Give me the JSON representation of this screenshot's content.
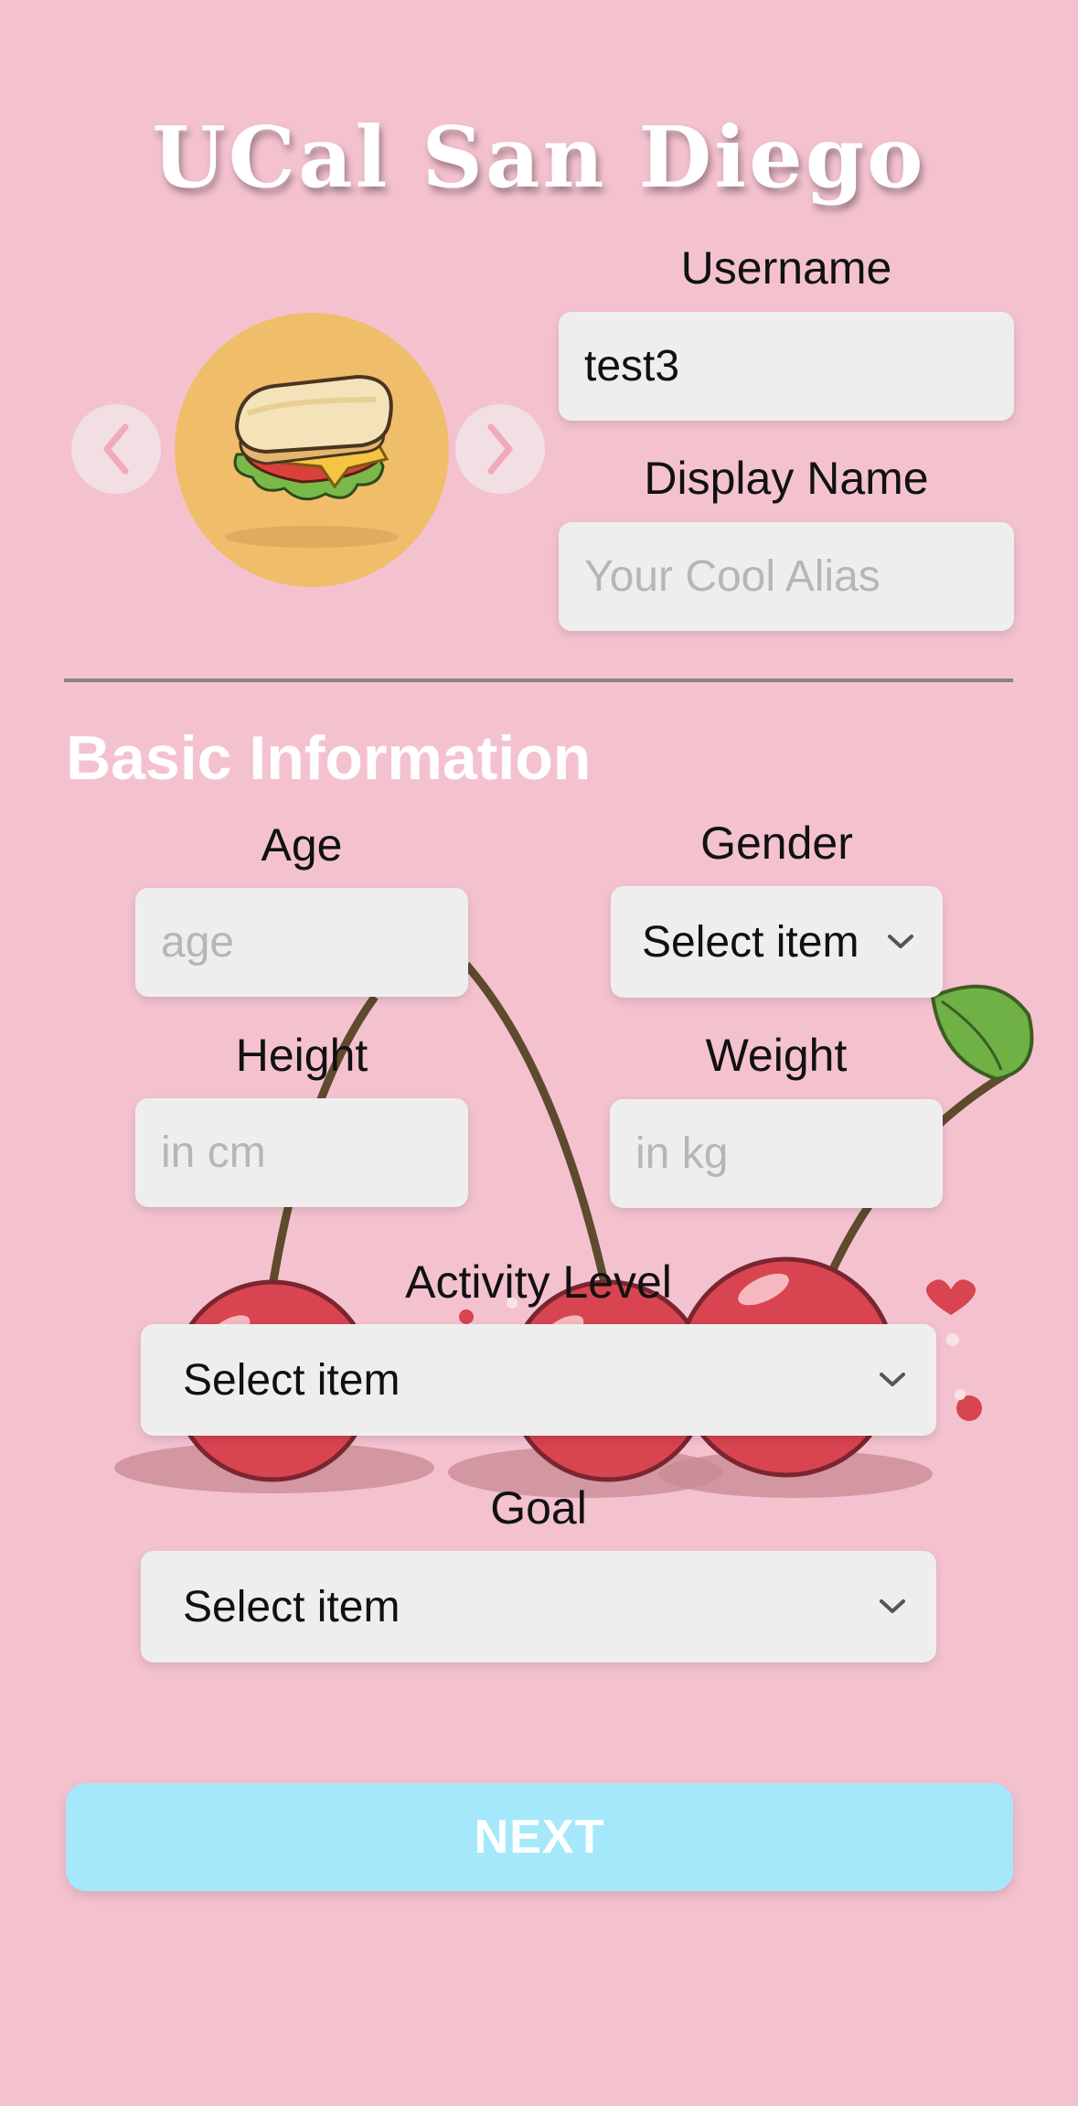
{
  "app": {
    "title": "UCal San Diego"
  },
  "profile": {
    "avatar_icon": "sandwich-icon",
    "prev_icon": "chevron-left-icon",
    "next_icon": "chevron-right-icon",
    "username_label": "Username",
    "username_value": "test3",
    "display_name_label": "Display Name",
    "display_name_placeholder": "Your Cool Alias"
  },
  "basic_info": {
    "section_title": "Basic Information",
    "age_label": "Age",
    "age_placeholder": "age",
    "gender_label": "Gender",
    "gender_value": "Select item",
    "height_label": "Height",
    "height_placeholder": "in cm",
    "weight_label": "Weight",
    "weight_placeholder": "in kg",
    "activity_label": "Activity Level",
    "activity_value": "Select item",
    "goal_label": "Goal",
    "goal_value": "Select item"
  },
  "actions": {
    "next_label": "NEXT"
  },
  "colors": {
    "background": "#f4c2cf",
    "field": "#efeeee",
    "avatar_bg": "#f0bd6a",
    "next_button": "#a6e8fb",
    "cherry": "#d8444f"
  }
}
